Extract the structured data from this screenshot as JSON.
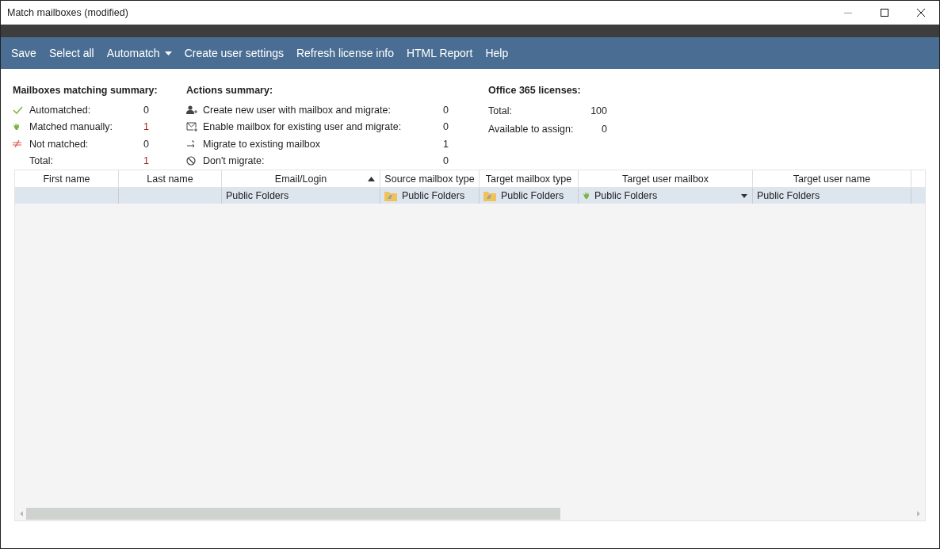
{
  "window": {
    "title": "Match mailboxes (modified)"
  },
  "toolbar": [
    {
      "label": "Save",
      "has_menu": false
    },
    {
      "label": "Select all",
      "has_menu": false
    },
    {
      "label": "Automatch",
      "has_menu": true
    },
    {
      "label": "Create user settings",
      "has_menu": false
    },
    {
      "label": "Refresh license info",
      "has_menu": false
    },
    {
      "label": "HTML Report",
      "has_menu": false
    },
    {
      "label": "Help",
      "has_menu": false
    }
  ],
  "summaries": [
    {
      "title": "Mailboxes matching summary:",
      "items": [
        {
          "kind": "check",
          "label": "Automatched:",
          "value": "0",
          "emphasized": false
        },
        {
          "kind": "hand",
          "label": "Matched manually:",
          "value": "1",
          "emphasized": true
        },
        {
          "kind": "notequal",
          "label": "Not matched:",
          "value": "0",
          "emphasized": false
        },
        {
          "kind": "none",
          "label": "Total:",
          "value": "1",
          "emphasized": true
        }
      ]
    },
    {
      "title": "Actions summary:",
      "items": [
        {
          "kind": "user-plus",
          "label": "Create new user with mailbox and migrate:",
          "value": "0",
          "emphasized": false
        },
        {
          "kind": "mail-plus",
          "label": "Enable mailbox for existing user and migrate:",
          "value": "0",
          "emphasized": false
        },
        {
          "kind": "arrow",
          "label": "Migrate to existing mailbox",
          "value": "1",
          "emphasized": false
        },
        {
          "kind": "forbidden",
          "label": "Don't migrate:",
          "value": "0",
          "emphasized": false
        }
      ]
    },
    {
      "title": "Office 365 licenses:",
      "items": [
        {
          "kind": "none",
          "label": "Total:",
          "value": "100",
          "emphasized": false
        },
        {
          "kind": "none",
          "label": "Available to assign:",
          "value": "0",
          "emphasized": false
        }
      ]
    }
  ],
  "table": {
    "columns": [
      {
        "label": "First name",
        "sorted_ascending": false
      },
      {
        "label": "Last name",
        "sorted_ascending": false
      },
      {
        "label": "Email/Login",
        "sorted_ascending": true
      },
      {
        "label": "Source mailbox type",
        "sorted_ascending": false
      },
      {
        "label": "Target mailbox type",
        "sorted_ascending": false
      },
      {
        "label": "Target user mailbox",
        "sorted_ascending": false
      },
      {
        "label": "Target user name",
        "sorted_ascending": false
      }
    ],
    "rows": [
      {
        "selected": true,
        "cells": [
          {
            "kind": "blank",
            "has_dropdown": false
          },
          {
            "kind": "blank",
            "has_dropdown": false
          },
          {
            "kind": "plain",
            "text": "Public Folders",
            "has_dropdown": false
          },
          {
            "kind": "folder",
            "text": "Public Folders",
            "has_dropdown": false
          },
          {
            "kind": "folder",
            "text": "Public Folders",
            "has_dropdown": false
          },
          {
            "kind": "hand",
            "text": "Public Folders",
            "has_dropdown": true
          },
          {
            "kind": "plain",
            "text": "Public Folders",
            "has_dropdown": false
          }
        ]
      }
    ]
  }
}
